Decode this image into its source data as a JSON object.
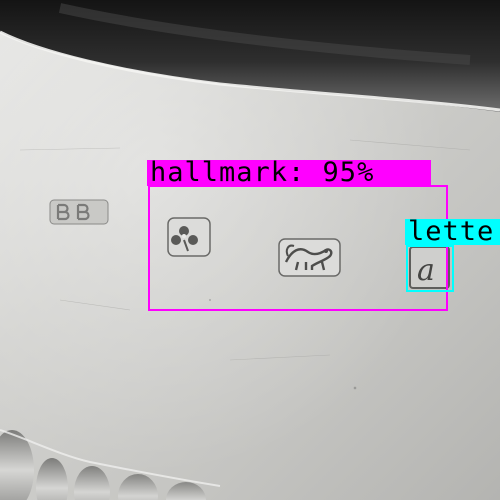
{
  "colors": {
    "hallmark": "#ff00ff",
    "letter": "#00ffff",
    "label_text": "#000000"
  },
  "detections": {
    "hallmark": {
      "label": "hallmark: 95%",
      "class": "hallmark",
      "score": 0.95
    },
    "letter": {
      "label": "lette",
      "class": "letter"
    }
  }
}
